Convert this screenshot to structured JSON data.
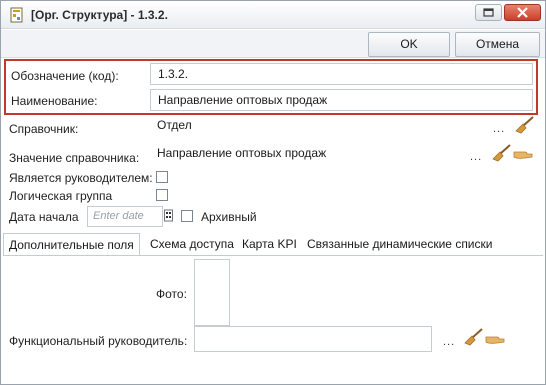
{
  "window": {
    "title": "[Орг. Структура] - 1.3.2."
  },
  "toolbar": {
    "ok_label": "OK",
    "cancel_label": "Отмена"
  },
  "form": {
    "code_label": "Обозначение (код):",
    "code_value": "1.3.2.",
    "name_label": "Наименование:",
    "name_value": "Направление оптовых продаж",
    "directory_label": "Справочник:",
    "directory_value": "Отдел",
    "directory_value_label": "Значение справочника:",
    "directory_value_value": "Направление оптовых продаж",
    "is_manager_label": "Является руководителем:",
    "is_manager_checked": false,
    "logical_group_label": "Логическая группа",
    "logical_group_checked": false,
    "start_date_label": "Дата начала",
    "start_date_placeholder": "Enter date",
    "archived_label": "Архивный",
    "archived_checked": false,
    "dots": "..."
  },
  "tabs": [
    {
      "label": "Дополнительные поля",
      "active": true
    },
    {
      "label": "Схема доступа",
      "active": false
    },
    {
      "label": "Карта KPI",
      "active": false
    },
    {
      "label": "Связанные динамические списки",
      "active": false
    }
  ],
  "extra_fields": {
    "photo_label": "Фото:",
    "functional_manager_label": "Функциональный руководитель:",
    "functional_manager_value": ""
  },
  "colors": {
    "highlight_border": "#c0392b",
    "close_button": "#c8412a",
    "broom_handle": "#8a5a2b",
    "broom_head": "#d49a3a"
  },
  "icons": {
    "app": "document-org-icon",
    "restore": "restore-window-icon",
    "close": "close-window-icon",
    "broom": "broom-clear-icon",
    "hand": "hand-pointer-icon"
  }
}
